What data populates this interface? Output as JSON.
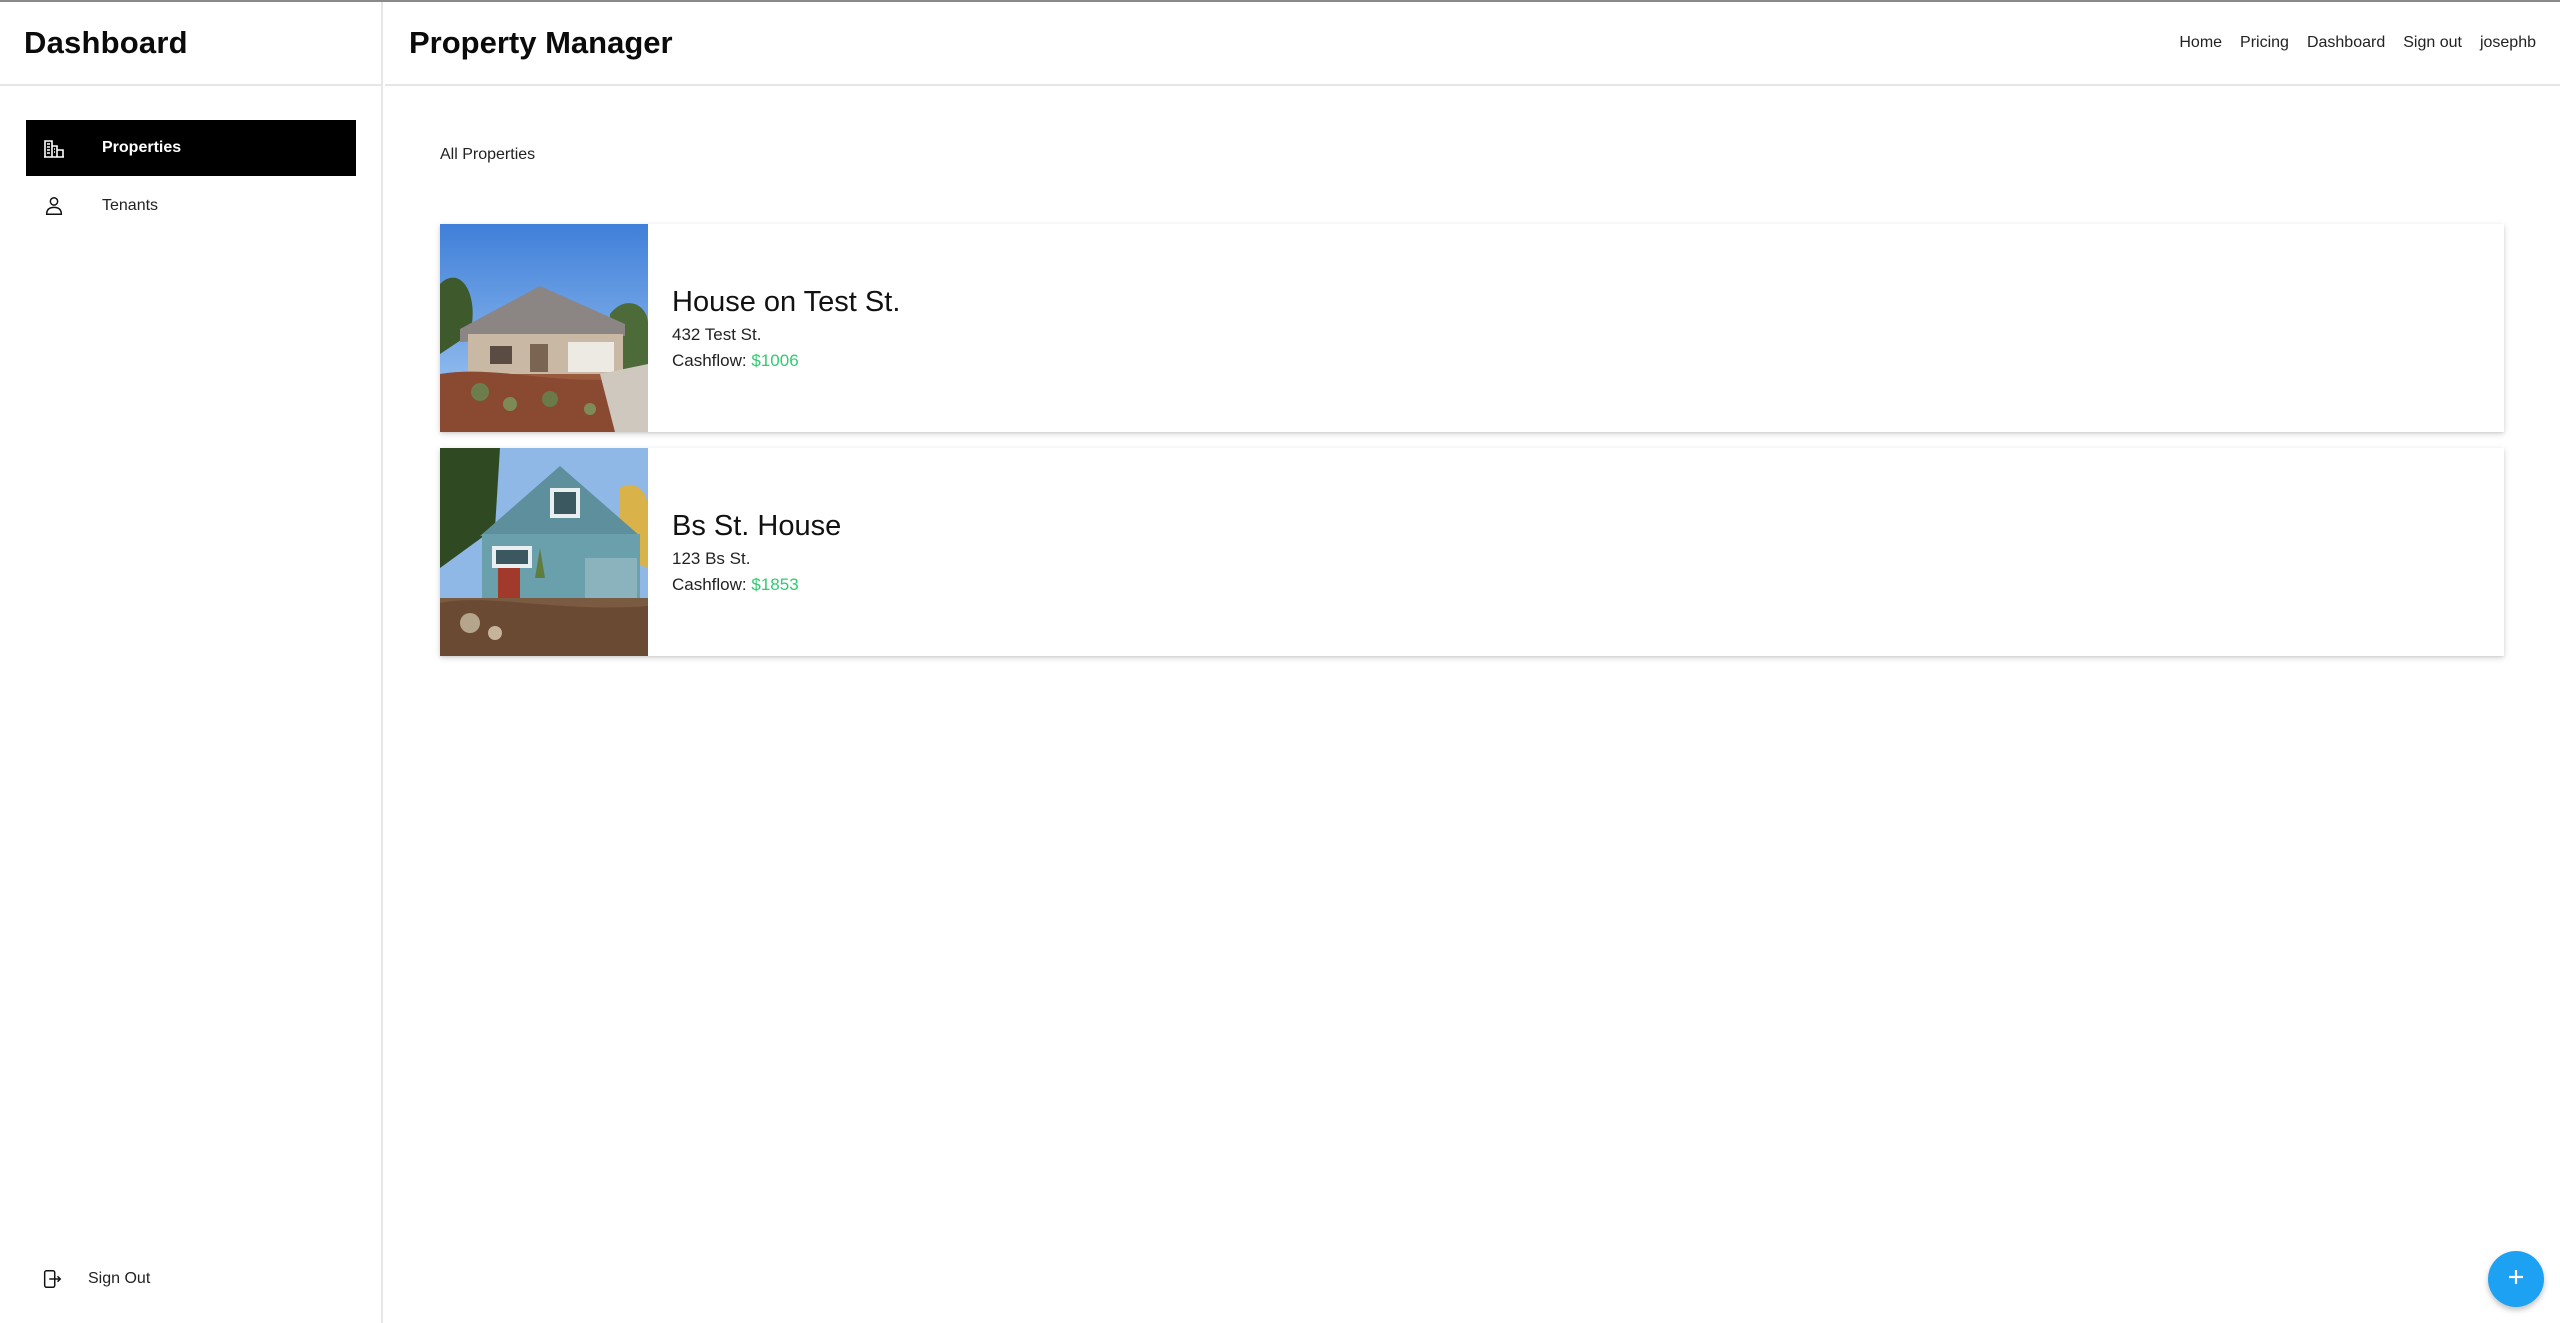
{
  "sidebar": {
    "title": "Dashboard",
    "items": [
      {
        "label": "Properties",
        "icon": "building-icon",
        "active": true
      },
      {
        "label": "Tenants",
        "icon": "person-icon",
        "active": false
      }
    ],
    "signout_label": "Sign Out"
  },
  "header": {
    "title": "Property Manager",
    "nav": [
      "Home",
      "Pricing",
      "Dashboard",
      "Sign out",
      "josephb"
    ]
  },
  "main": {
    "breadcrumb": "All Properties",
    "properties": [
      {
        "name": "House on Test St.",
        "address": "432 Test St.",
        "cashflow_label": "Cashflow:",
        "cashflow": "$1006"
      },
      {
        "name": "Bs St. House",
        "address": "123 Bs St.",
        "cashflow_label": "Cashflow:",
        "cashflow": "$1853"
      }
    ]
  },
  "colors": {
    "accent": "#1da1f2",
    "cashflow_positive": "#2ecc71",
    "active_nav": "#000000"
  },
  "icons": {
    "fab": "plus-icon"
  }
}
